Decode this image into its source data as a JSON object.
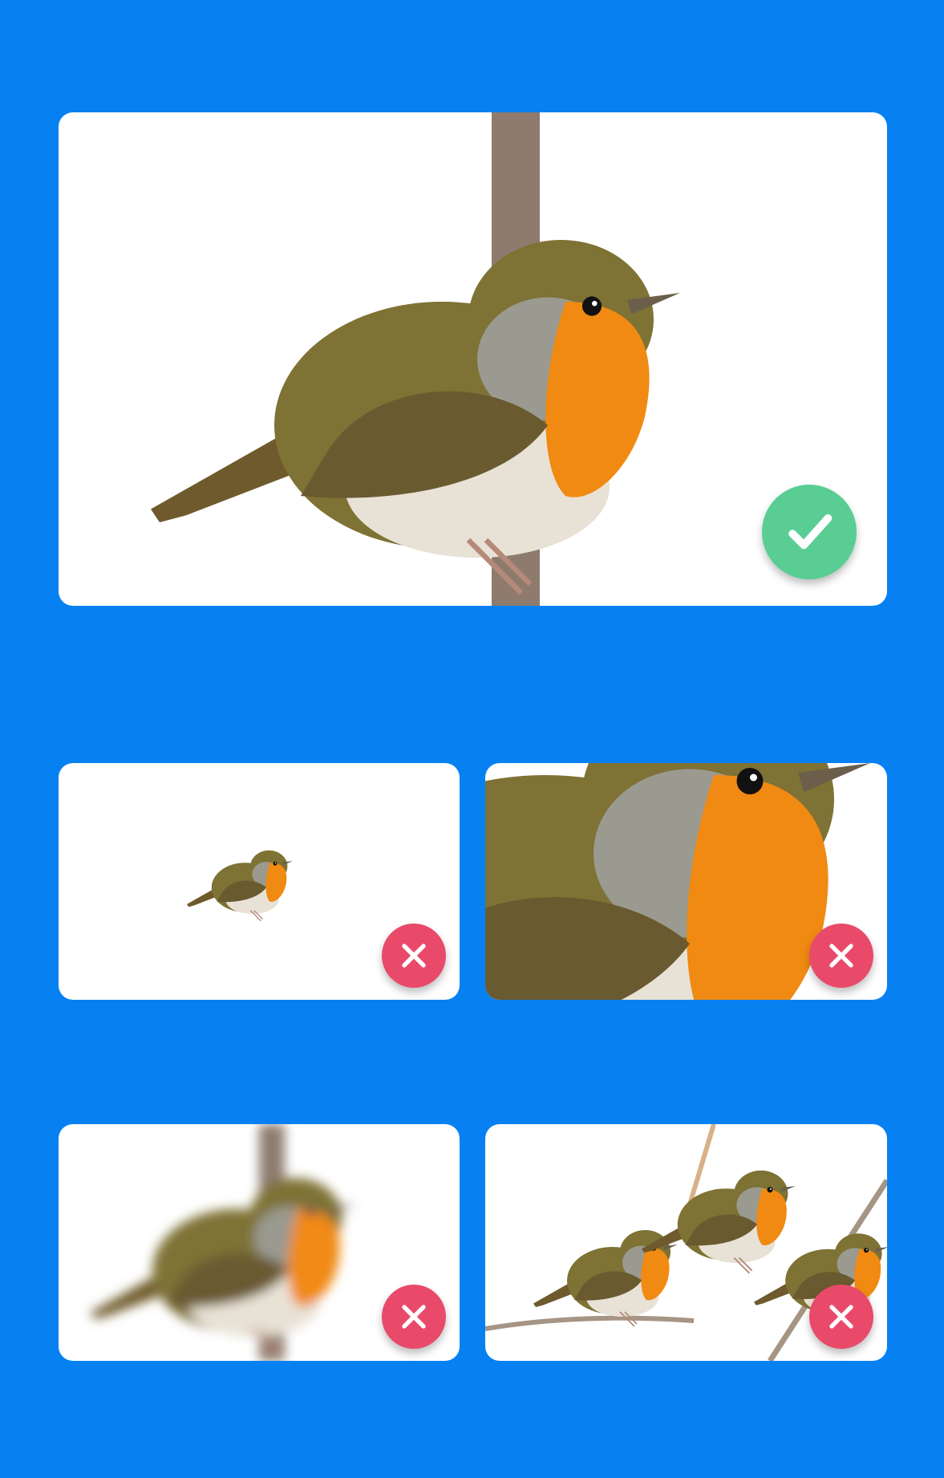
{
  "colors": {
    "background": "#0781F2",
    "card": "#ffffff",
    "ok_badge": "#5ACD94",
    "bad_badge": "#E94A6A",
    "bird_body": "#7E7234",
    "bird_breast": "#F18A12",
    "bird_belly": "#E8E2D6",
    "branch": "#8E7B6E"
  },
  "examples": [
    {
      "id": "correct-photo",
      "status": "correct",
      "icon": "checkmark-icon"
    },
    {
      "id": "too-small-photo",
      "status": "incorrect",
      "icon": "cross-icon"
    },
    {
      "id": "too-close-photo",
      "status": "incorrect",
      "icon": "cross-icon"
    },
    {
      "id": "blurry-photo",
      "status": "incorrect",
      "icon": "cross-icon"
    },
    {
      "id": "multiple-birds-photo",
      "status": "incorrect",
      "icon": "cross-icon"
    }
  ]
}
